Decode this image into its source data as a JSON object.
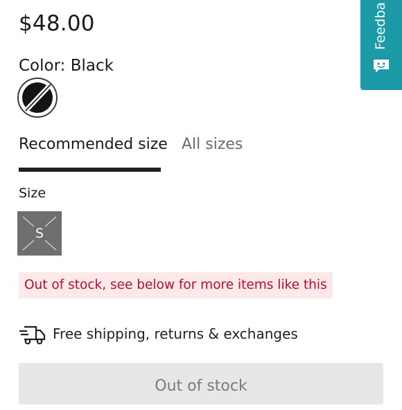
{
  "product": {
    "price": "$48.00",
    "color_label": "Color:",
    "color_value": "Black",
    "swatch_name": "black-swatch-icon"
  },
  "size_tabs": [
    {
      "label": "Recommended size",
      "active": true
    },
    {
      "label": "All sizes",
      "active": false
    }
  ],
  "size": {
    "label": "Size",
    "options": [
      {
        "value": "S",
        "available": false
      }
    ]
  },
  "stock_notice": "Out of stock, see below for more items like this",
  "shipping": {
    "icon": "fast-delivery-truck-icon",
    "text": "Free shipping, returns & exchanges"
  },
  "cta": {
    "label": "Out of stock",
    "disabled": true
  },
  "feedback_tab": {
    "label": "Feedba",
    "icon": "smiley-chat-icon"
  },
  "colors": {
    "notice_bg": "#fde8ea",
    "notice_text": "#b80f2d",
    "feedback_bg": "#1c9aa8",
    "button_bg": "#e7e7e7"
  }
}
